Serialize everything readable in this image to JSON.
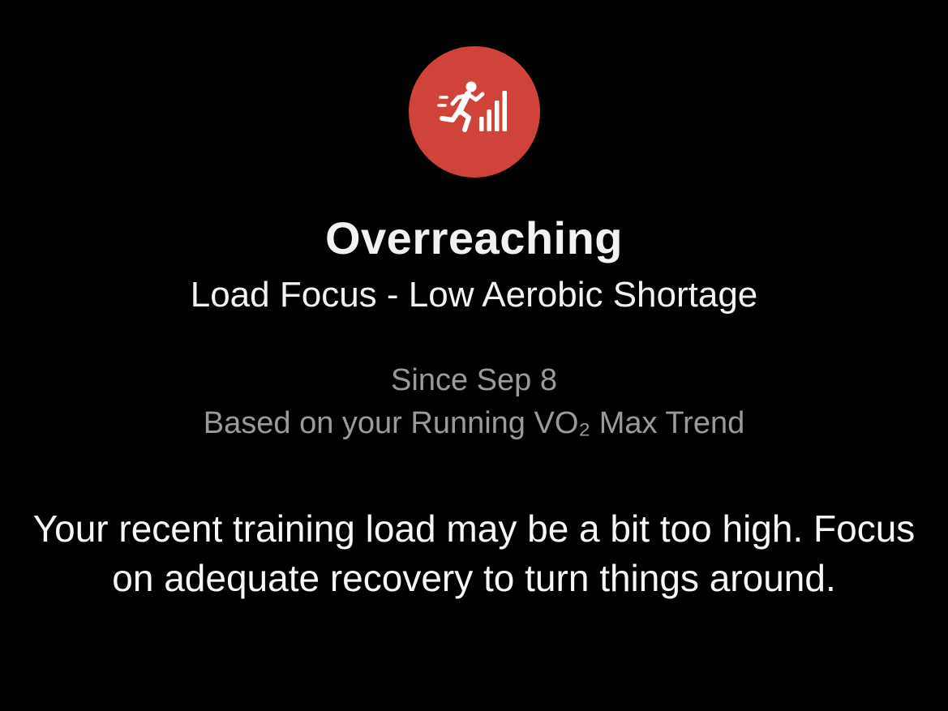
{
  "status": {
    "icon": "running-load-icon",
    "icon_color": "#d0433a",
    "title": "Overreaching",
    "subtitle": "Load Focus - Low Aerobic Shortage"
  },
  "details": {
    "since": "Since Sep 8",
    "based_on": "Based on your Running VO₂ Max Trend"
  },
  "description": "Your recent training load may be a bit too high. Focus on adequate recovery to turn things around."
}
